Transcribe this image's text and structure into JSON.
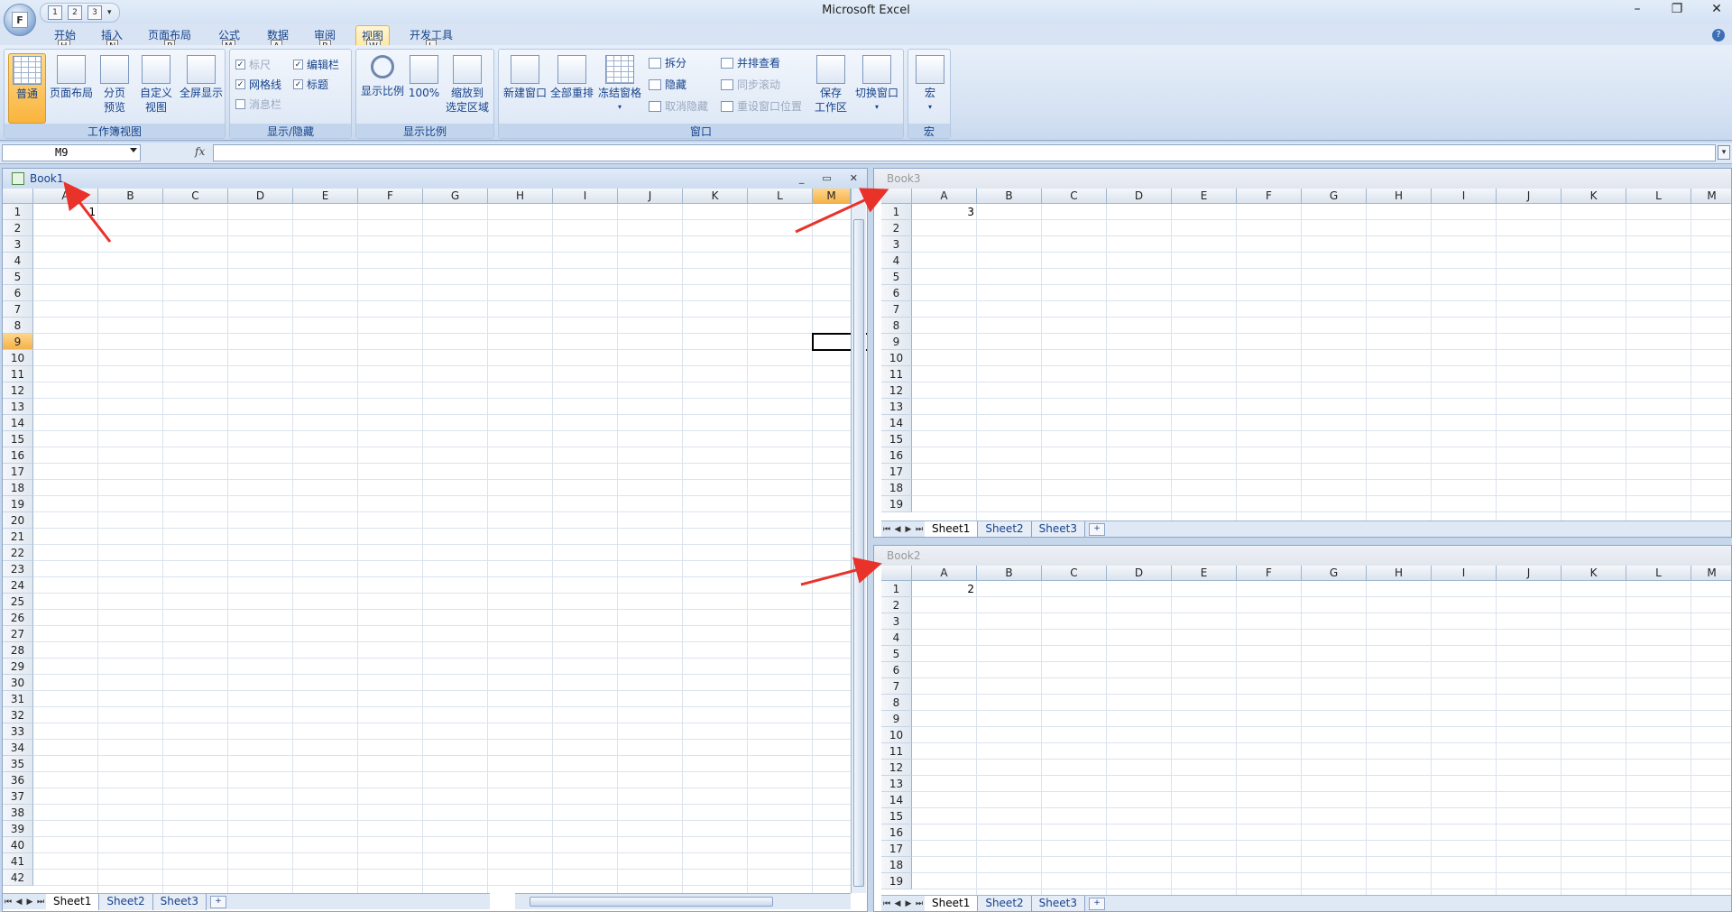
{
  "app": {
    "title": "Microsoft Excel",
    "office_button_letter": "F"
  },
  "qat": {
    "items": [
      "1",
      "2",
      "3"
    ]
  },
  "window_controls": {
    "minimize": "–",
    "restore": "❐",
    "close": "✕"
  },
  "tabs": [
    {
      "label": "开始",
      "key": "H"
    },
    {
      "label": "插入",
      "key": "N"
    },
    {
      "label": "页面布局",
      "key": "P"
    },
    {
      "label": "公式",
      "key": "M"
    },
    {
      "label": "数据",
      "key": "A"
    },
    {
      "label": "审阅",
      "key": "R"
    },
    {
      "label": "视图",
      "key": "W",
      "active": true
    },
    {
      "label": "开发工具",
      "key": "L"
    }
  ],
  "ribbon": {
    "workbook_views": {
      "label": "工作簿视图",
      "normal": "普通",
      "page_layout": "页面布局",
      "page_break_l1": "分页",
      "page_break_l2": "预览",
      "custom_l1": "自定义",
      "custom_l2": "视图",
      "full_screen": "全屏显示"
    },
    "show_hide": {
      "label": "显示/隐藏",
      "ruler": "标尺",
      "gridlines": "网格线",
      "message_bar": "消息栏",
      "formula_bar": "编辑栏",
      "headings": "标题"
    },
    "zoom": {
      "label": "显示比例",
      "zoom": "显示比例",
      "hundred": "100%",
      "zoom_sel_l1": "缩放到",
      "zoom_sel_l2": "选定区域"
    },
    "window": {
      "label": "窗口",
      "new_window": "新建窗口",
      "arrange_all": "全部重排",
      "freeze": "冻结窗格",
      "split": "拆分",
      "hide": "隐藏",
      "unhide": "取消隐藏",
      "side_by_side": "并排查看",
      "sync_scroll": "同步滚动",
      "reset_pos": "重设窗口位置",
      "save_ws_l1": "保存",
      "save_ws_l2": "工作区",
      "switch": "切换窗口"
    },
    "macros": {
      "label": "宏",
      "macros": "宏"
    }
  },
  "formula_bar": {
    "name_box": "M9",
    "fx": "fx",
    "formula": ""
  },
  "book1": {
    "title": "Book1",
    "controls": {
      "min": "_",
      "max": "▭",
      "close": "✕"
    },
    "columns": [
      "A",
      "B",
      "C",
      "D",
      "E",
      "F",
      "G",
      "H",
      "I",
      "J",
      "K",
      "L",
      "M"
    ],
    "rows": [
      "1",
      "2",
      "3",
      "4",
      "5",
      "6",
      "7",
      "8",
      "9",
      "10",
      "11",
      "12",
      "13",
      "14",
      "15",
      "16",
      "17",
      "18",
      "19",
      "20",
      "21",
      "22",
      "23",
      "24",
      "25",
      "26",
      "27",
      "28",
      "29",
      "30",
      "31",
      "32",
      "33",
      "34",
      "35",
      "36",
      "37",
      "38",
      "39",
      "40",
      "41",
      "42"
    ],
    "cell_a1": "1",
    "sheets": [
      "Sheet1",
      "Sheet2",
      "Sheet3"
    ]
  },
  "book3": {
    "title": "Book3",
    "columns": [
      "A",
      "B",
      "C",
      "D",
      "E",
      "F",
      "G",
      "H",
      "I",
      "J",
      "K",
      "L",
      "M"
    ],
    "rows": [
      "1",
      "2",
      "3",
      "4",
      "5",
      "6",
      "7",
      "8",
      "9",
      "10",
      "11",
      "12",
      "13",
      "14",
      "15",
      "16",
      "17",
      "18",
      "19"
    ],
    "cell_a1": "3",
    "sheets": [
      "Sheet1",
      "Sheet2",
      "Sheet3"
    ]
  },
  "book2": {
    "title": "Book2",
    "columns": [
      "A",
      "B",
      "C",
      "D",
      "E",
      "F",
      "G",
      "H",
      "I",
      "J",
      "K",
      "L",
      "M"
    ],
    "rows": [
      "1",
      "2",
      "3",
      "4",
      "5",
      "6",
      "7",
      "8",
      "9",
      "10",
      "11",
      "12",
      "13",
      "14",
      "15",
      "16",
      "17",
      "18",
      "19"
    ],
    "cell_a1": "2",
    "sheets": [
      "Sheet1",
      "Sheet2",
      "Sheet3"
    ]
  },
  "colors": {
    "accent": "#15428b",
    "arrow": "#e8322a",
    "active_tab": "#ffe7a2"
  }
}
